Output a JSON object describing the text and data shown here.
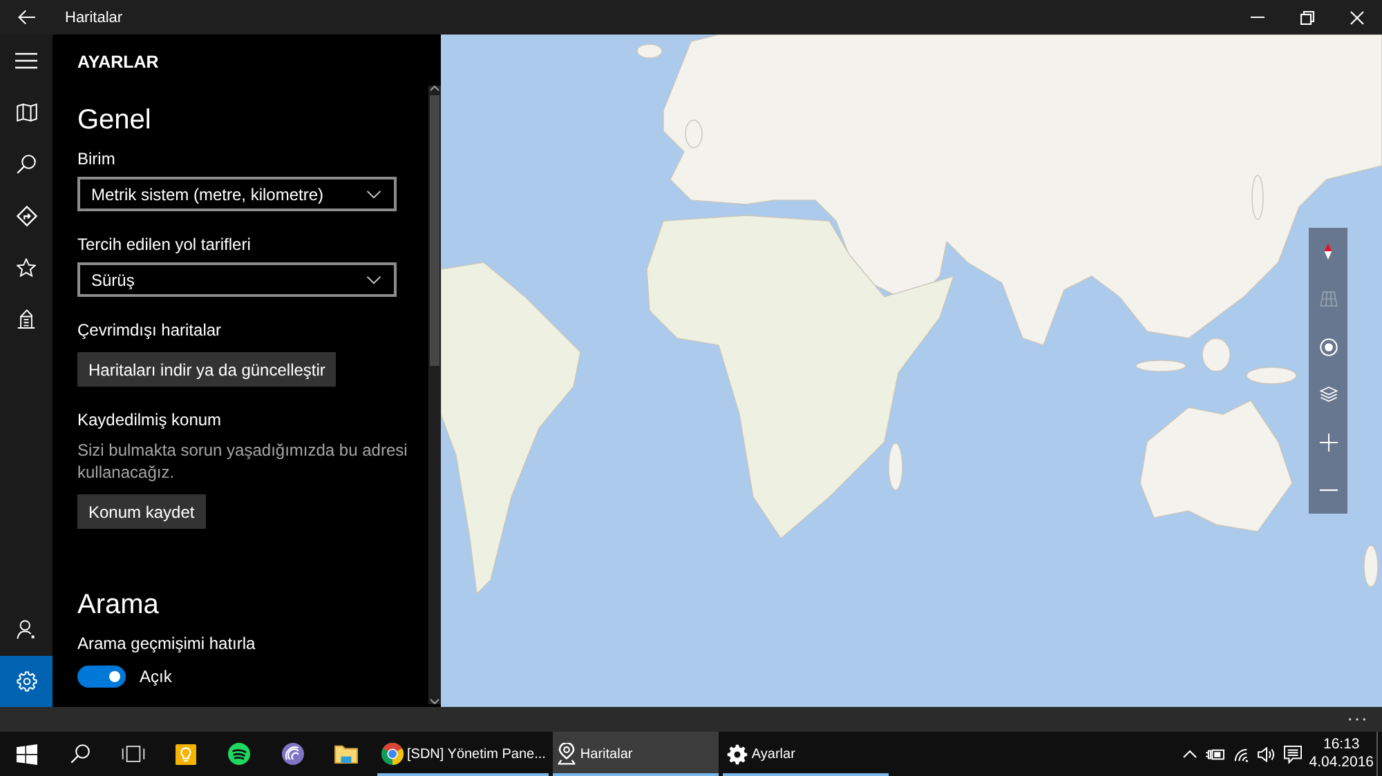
{
  "window": {
    "title": "Haritalar"
  },
  "nav_rail": {
    "top_items": [
      {
        "kind": "menu",
        "selected": false
      },
      {
        "kind": "map",
        "selected": false
      },
      {
        "kind": "search",
        "selected": false
      },
      {
        "kind": "directions",
        "selected": false
      },
      {
        "kind": "favorites",
        "selected": false
      },
      {
        "kind": "cities",
        "selected": false
      }
    ],
    "bottom_items": [
      {
        "kind": "account",
        "selected": false
      },
      {
        "kind": "settings",
        "selected": true
      }
    ]
  },
  "settings": {
    "title": "AYARLAR",
    "sections": [
      {
        "title": "Genel",
        "items": [
          {
            "kind": "dropdown",
            "label": "Birim",
            "value": "Metrik sistem (metre, kilometre)"
          },
          {
            "kind": "dropdown",
            "label": "Tercih edilen yol tarifleri",
            "value": "Sürüş"
          },
          {
            "kind": "button",
            "label": "Çevrimdışı haritalar",
            "button": "Haritaları indir ya da güncelleştir"
          },
          {
            "kind": "button",
            "label": "Kaydedilmiş konum",
            "description": "Sizi bulmakta sorun yaşadığımızda bu adresi kullanacağız.",
            "button": "Konum kaydet"
          }
        ]
      },
      {
        "title": "Arama",
        "items": [
          {
            "kind": "toggle",
            "label": "Arama geçmişimi hatırla",
            "on": true,
            "state_text": "Açık"
          }
        ]
      }
    ]
  },
  "map_controls": [
    {
      "kind": "compass",
      "disabled": false
    },
    {
      "kind": "grid",
      "disabled": true
    },
    {
      "kind": "locate",
      "disabled": false
    },
    {
      "kind": "layers",
      "disabled": false
    },
    {
      "kind": "zoom_in",
      "disabled": false
    },
    {
      "kind": "zoom_out",
      "disabled": false
    }
  ],
  "taskbar": {
    "pinned": [
      {
        "kind": "start"
      },
      {
        "kind": "search"
      },
      {
        "kind": "task_view"
      },
      {
        "kind": "sticky_notes"
      },
      {
        "kind": "music"
      },
      {
        "kind": "torrent"
      },
      {
        "kind": "explorer"
      }
    ],
    "apps": [
      {
        "kind": "browser",
        "label": "[SDN] Yönetim Pane...",
        "selected": false
      },
      {
        "kind": "maps",
        "label": "Haritalar",
        "selected": true
      },
      {
        "kind": "settings",
        "label": "Ayarlar",
        "selected": false
      }
    ],
    "clock": {
      "time": "16:13",
      "date": "4.04.2016"
    }
  }
}
